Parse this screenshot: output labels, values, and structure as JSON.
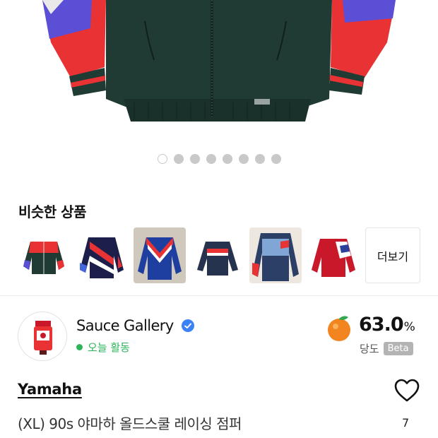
{
  "hero": {
    "image_icon": "racing-jacket-photo",
    "slide_count": 8,
    "active_slide": 1
  },
  "similar": {
    "title": "비슷한 상품",
    "items": [
      {
        "icon": "jacket-thumbnail-1"
      },
      {
        "icon": "jacket-thumbnail-2"
      },
      {
        "icon": "jacket-thumbnail-3"
      },
      {
        "icon": "jacket-thumbnail-4"
      },
      {
        "icon": "jacket-thumbnail-5"
      },
      {
        "icon": "jacket-thumbnail-6"
      }
    ],
    "more_label": "더보기"
  },
  "seller": {
    "name": "Sauce Gallery",
    "verified_icon": "verified-check-icon",
    "activity": "오늘 활동",
    "score": "63.0",
    "score_unit": "%",
    "score_icon": "orange-fruit-icon",
    "sweetness_label": "당도",
    "beta_label": "Beta"
  },
  "product": {
    "brand": "Yamaha",
    "title": "(XL) 90s 야마하 올드스쿨 레이싱 점퍼",
    "likes": "7",
    "heart_icon": "heart-outline-icon"
  },
  "colors": {
    "jacket_green": "#1f3b33",
    "sleeve_red": "#e83234",
    "sleeve_purple": "#5b4fd6",
    "active_green": "#2fb45e",
    "orange": "#f2851f"
  }
}
